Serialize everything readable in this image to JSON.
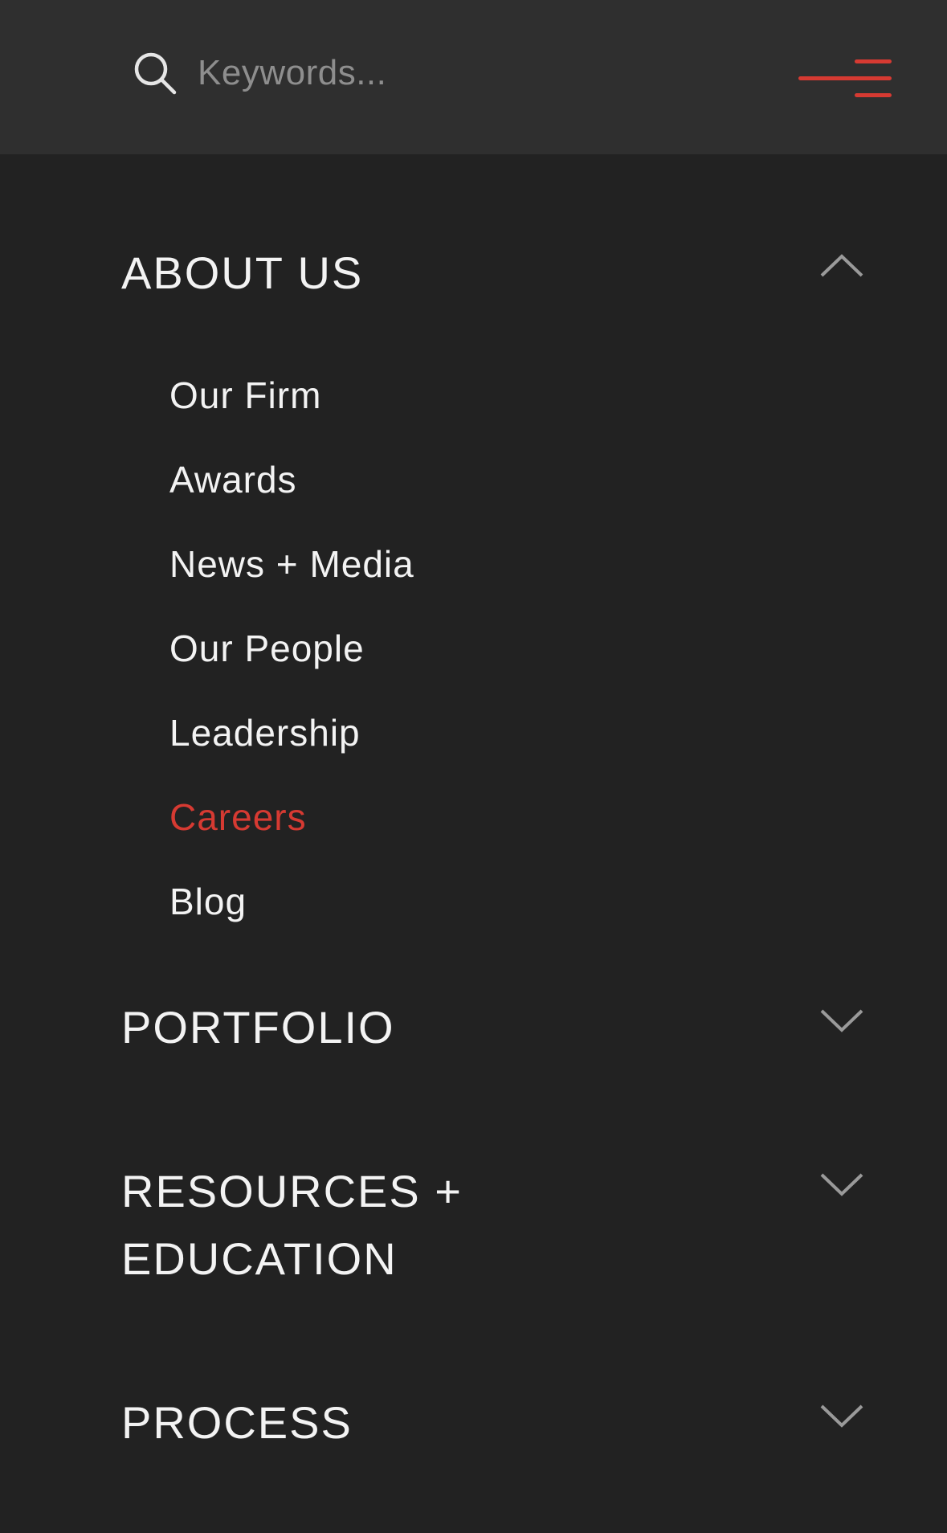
{
  "colors": {
    "header_bg": "#2f2f2f",
    "page_bg": "#222222",
    "accent": "#d63a32",
    "text": "#f3f3f3",
    "muted": "#8e8e8e",
    "icon": "#e6e6e6",
    "chevron": "#9a9a9a"
  },
  "search": {
    "icon": "search-icon",
    "placeholder": "Keywords...",
    "value": ""
  },
  "menu": {
    "icon": "hamburger-menu-icon"
  },
  "nav": {
    "sections": [
      {
        "title": "ABOUT US",
        "state": "expanded",
        "icon": "chevron-up-icon",
        "items": [
          {
            "label": "Our Firm",
            "active": false
          },
          {
            "label": "Awards",
            "active": false
          },
          {
            "label": "News + Media",
            "active": false
          },
          {
            "label": "Our People",
            "active": false
          },
          {
            "label": "Leadership",
            "active": false
          },
          {
            "label": "Careers",
            "active": true
          },
          {
            "label": "Blog",
            "active": false
          }
        ]
      },
      {
        "title": "PORTFOLIO",
        "state": "collapsed",
        "icon": "chevron-down-icon"
      },
      {
        "title_lines": [
          "RESOURCES +",
          "EDUCATION"
        ],
        "state": "collapsed",
        "icon": "chevron-down-icon"
      },
      {
        "title": "PROCESS",
        "state": "collapsed",
        "icon": "chevron-down-icon"
      }
    ]
  }
}
